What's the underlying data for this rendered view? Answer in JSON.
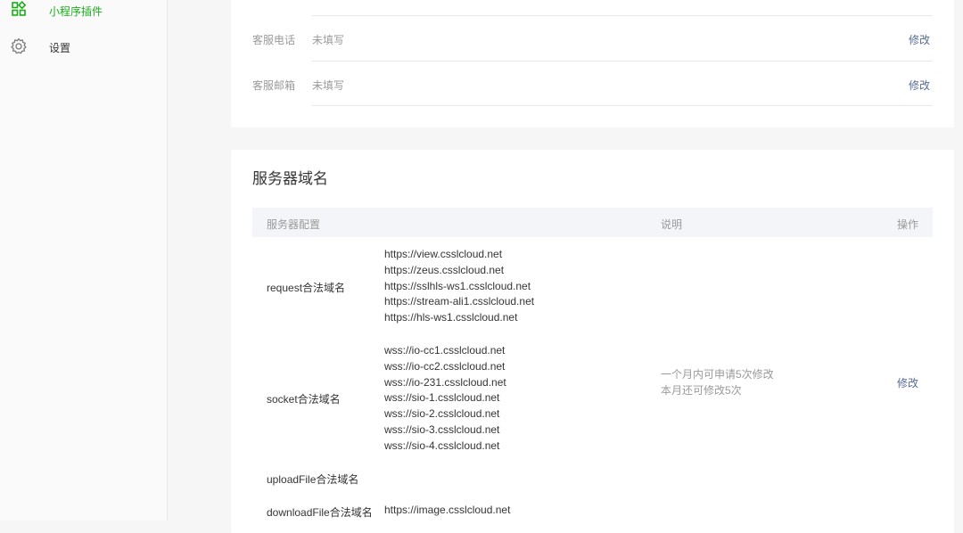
{
  "sidebar": {
    "items": [
      {
        "label": "小程序插件",
        "icon": "plugin-grid-icon",
        "active": true
      },
      {
        "label": "设置",
        "icon": "gear-icon",
        "active": false
      }
    ]
  },
  "contact": {
    "phone_label": "客服电话",
    "phone_value": "未填写",
    "phone_action": "修改",
    "email_label": "客服邮箱",
    "email_value": "未填写",
    "email_action": "修改"
  },
  "server": {
    "title": "服务器域名",
    "headers": {
      "config": "服务器配置",
      "desc": "说明",
      "op": "操作"
    },
    "request_label": "request合法域名",
    "request_urls": [
      "https://view.csslcloud.net",
      "https://zeus.csslcloud.net",
      "https://sslhls-ws1.csslcloud.net",
      "https://stream-ali1.csslcloud.net",
      "https://hls-ws1.csslcloud.net"
    ],
    "socket_label": "socket合法域名",
    "socket_urls": [
      "wss://io-cc1.csslcloud.net",
      "wss://io-cc2.csslcloud.net",
      "wss://io-231.csslcloud.net",
      "wss://sio-1.csslcloud.net",
      "wss://sio-2.csslcloud.net",
      "wss://sio-3.csslcloud.net",
      "wss://sio-4.csslcloud.net"
    ],
    "upload_label": "uploadFile合法域名",
    "download_label": "downloadFile合法域名",
    "download_urls": [
      "https://image.csslcloud.net"
    ],
    "desc_line1": "一个月内可申请5次修改",
    "desc_line2": "本月还可修改5次",
    "action": "修改"
  },
  "colors": {
    "accent_green": "#1aad19",
    "link_blue": "#576b95"
  }
}
